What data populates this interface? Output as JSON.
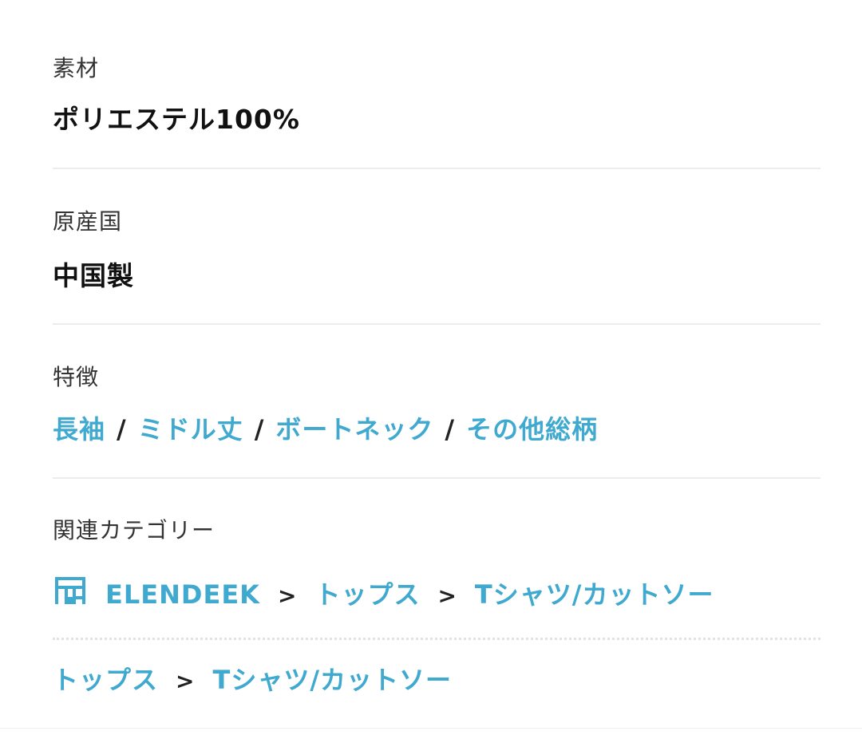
{
  "material": {
    "label": "素材",
    "value": "ポリエステル100%"
  },
  "origin": {
    "label": "原産国",
    "value": "中国製"
  },
  "features": {
    "label": "特徴",
    "items": [
      "長袖",
      "ミドル丈",
      "ボートネック",
      "その他総柄"
    ],
    "separator": "/"
  },
  "categories": {
    "label": "関連カテゴリー",
    "brand_icon": "shop-icon",
    "row1": [
      "ELENDEEK",
      "トップス",
      "Tシャツ/カットソー"
    ],
    "row2": [
      "トップス",
      "Tシャツ/カットソー"
    ],
    "separator": ">"
  },
  "colors": {
    "link": "#3fa9cf",
    "text": "#111111",
    "label": "#333333",
    "divider": "#ececec"
  }
}
